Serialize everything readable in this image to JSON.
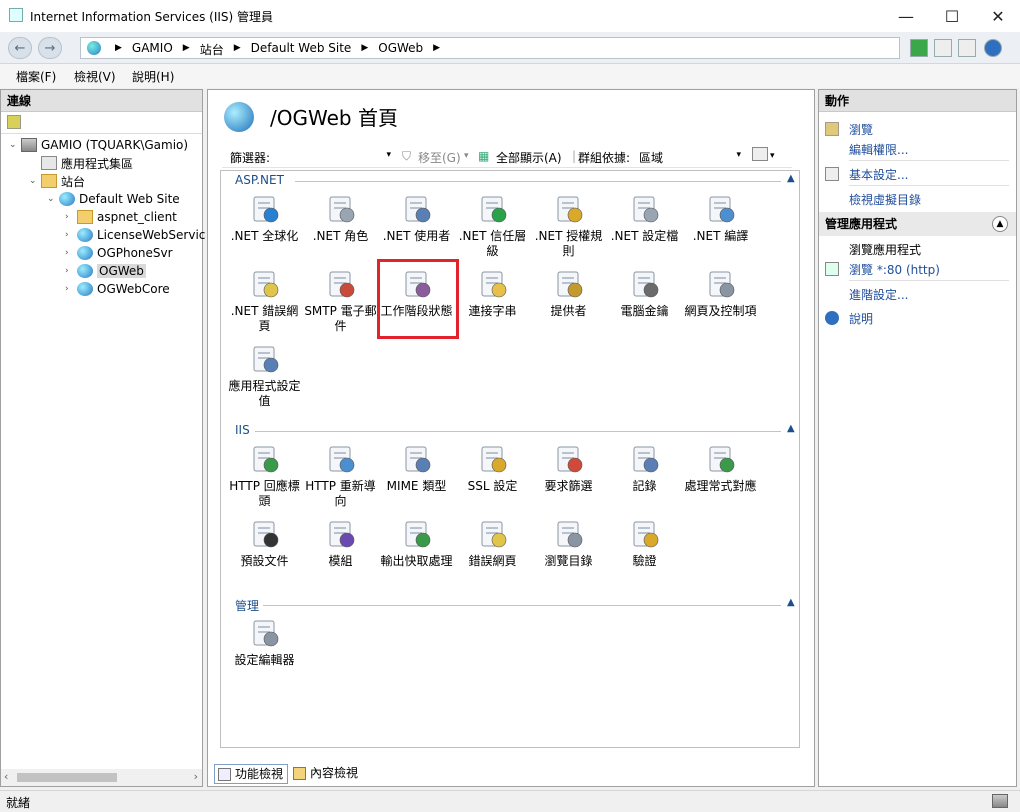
{
  "window": {
    "title": "Internet Information Services (IIS) 管理員",
    "min": "—",
    "max": "☐",
    "close": "✕"
  },
  "address": {
    "back": "←",
    "forward": "→",
    "crumbs": [
      "GAMIO",
      "站台",
      "Default Web Site",
      "OGWeb"
    ],
    "sep": "▶"
  },
  "menu": [
    "檔案(F)",
    "檢視(V)",
    "說明(H)"
  ],
  "connections": {
    "header": "連線",
    "tree": [
      {
        "label": "GAMIO (TQUARK\\Gamio)",
        "icon": "server-icon",
        "twisty": "⌄"
      },
      {
        "label": "應用程式集區",
        "icon": "app-pool-icon",
        "twisty": ""
      },
      {
        "label": "站台",
        "icon": "folder-icon",
        "twisty": "⌄"
      },
      {
        "label": "Default Web Site",
        "icon": "globe-icon",
        "twisty": "⌄"
      },
      {
        "label": "aspnet_client",
        "icon": "folder-icon",
        "twisty": "›"
      },
      {
        "label": "LicenseWebServic",
        "icon": "globe-icon",
        "twisty": "›"
      },
      {
        "label": "OGPhoneSvr",
        "icon": "globe-icon",
        "twisty": "›"
      },
      {
        "label": "OGWeb",
        "icon": "globe-icon",
        "twisty": "›"
      },
      {
        "label": "OGWebCore",
        "icon": "globe-icon",
        "twisty": "›"
      }
    ]
  },
  "main": {
    "title": "/OGWeb 首頁",
    "filter": {
      "label": "篩選器:",
      "go": "移至(G)",
      "show_all": "全部顯示(A)",
      "group_label": "群組依據:",
      "group_value": "區域"
    },
    "groups": [
      {
        "name": "ASP.NET",
        "caret": "▲",
        "items": [
          {
            "label": ".NET 全球化",
            "icon": "globe-icon",
            "color": "#2a80d0"
          },
          {
            "label": ".NET 角色",
            "icon": "roles-icon",
            "color": "#9aa5b4"
          },
          {
            "label": ".NET 使用者",
            "icon": "users-icon",
            "color": "#5a7fb5"
          },
          {
            "label": ".NET 信任層級",
            "icon": "trust-icon",
            "color": "#2aa24a"
          },
          {
            "label": ".NET 授權規則",
            "icon": "lock-icon",
            "color": "#d8a92b"
          },
          {
            "label": ".NET 設定檔",
            "icon": "profile-icon",
            "color": "#9aa5b4"
          },
          {
            "label": ".NET 編譯",
            "icon": "compile-icon",
            "color": "#4d8fcf"
          },
          {
            "label": ".NET 錯誤網頁",
            "icon": "error-page-icon",
            "color": "#e0c54a"
          },
          {
            "label": "SMTP 電子郵件",
            "icon": "mail-icon",
            "color": "#c84a3a"
          },
          {
            "label": "工作階段狀態",
            "icon": "session-state-icon",
            "color": "#8a5c9c"
          },
          {
            "label": "連接字串",
            "icon": "connection-string-icon",
            "color": "#e6c04a"
          },
          {
            "label": "提供者",
            "icon": "providers-icon",
            "color": "#c39a2c"
          },
          {
            "label": "電腦金鑰",
            "icon": "machine-key-icon",
            "color": "#6b6b6b"
          },
          {
            "label": "網頁及控制項",
            "icon": "pages-controls-icon",
            "color": "#8a95a4"
          },
          {
            "label": "應用程式設定值",
            "icon": "app-settings-icon",
            "color": "#5a7fb5"
          }
        ]
      },
      {
        "name": "IIS",
        "caret": "▲",
        "items": [
          {
            "label": "HTTP 回應標頭",
            "icon": "http-headers-icon",
            "color": "#3a9a4a"
          },
          {
            "label": "HTTP 重新導向",
            "icon": "redirect-icon",
            "color": "#4a8fcf"
          },
          {
            "label": "MIME 類型",
            "icon": "mime-icon",
            "color": "#5a7fb5"
          },
          {
            "label": "SSL 設定",
            "icon": "ssl-lock-icon",
            "color": "#d8a92b"
          },
          {
            "label": "要求篩選",
            "icon": "request-filter-icon",
            "color": "#d04a3a"
          },
          {
            "label": "記錄",
            "icon": "logging-icon",
            "color": "#5a7fb5"
          },
          {
            "label": "處理常式對應",
            "icon": "handler-mappings-icon",
            "color": "#3a9a4a"
          },
          {
            "label": "預設文件",
            "icon": "default-doc-icon",
            "color": "#333333"
          },
          {
            "label": "模組",
            "icon": "modules-icon",
            "color": "#6a4ab0"
          },
          {
            "label": "輸出快取處理",
            "icon": "output-cache-icon",
            "color": "#3a9a4a"
          },
          {
            "label": "錯誤網頁",
            "icon": "error-pages-icon",
            "color": "#e0c54a"
          },
          {
            "label": "瀏覽目錄",
            "icon": "dir-browse-icon",
            "color": "#8a95a4"
          },
          {
            "label": "驗證",
            "icon": "auth-icon",
            "color": "#d8a92b"
          }
        ]
      },
      {
        "name": "管理",
        "caret": "▲",
        "items": [
          {
            "label": "設定編輯器",
            "icon": "config-editor-icon",
            "color": "#8a95a4"
          }
        ]
      }
    ],
    "bottom_tabs": [
      "功能檢視",
      "內容檢視"
    ]
  },
  "actions": {
    "header": "動作",
    "items": [
      "瀏覽",
      "編輯權限...",
      "基本設定...",
      "檢視虛擬目錄"
    ],
    "manage_header": "管理應用程式",
    "collapse": "▲",
    "browse_header": "瀏覽應用程式",
    "browse_link": "瀏覽 *:80 (http)",
    "advanced": "進階設定...",
    "help": "說明"
  },
  "status": {
    "text": "就緒"
  },
  "highlight_color": "#e2232b"
}
